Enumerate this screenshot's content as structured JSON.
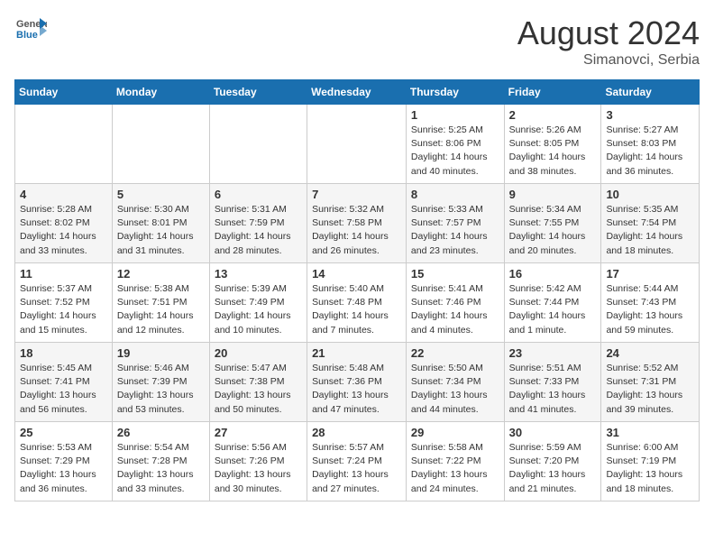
{
  "header": {
    "logo": {
      "general": "General",
      "blue": "Blue"
    },
    "title": "August 2024",
    "location": "Simanovci, Serbia"
  },
  "weekdays": [
    "Sunday",
    "Monday",
    "Tuesday",
    "Wednesday",
    "Thursday",
    "Friday",
    "Saturday"
  ],
  "weeks": [
    [
      {
        "day": "",
        "info": ""
      },
      {
        "day": "",
        "info": ""
      },
      {
        "day": "",
        "info": ""
      },
      {
        "day": "",
        "info": ""
      },
      {
        "day": "1",
        "info": "Sunrise: 5:25 AM\nSunset: 8:06 PM\nDaylight: 14 hours\nand 40 minutes."
      },
      {
        "day": "2",
        "info": "Sunrise: 5:26 AM\nSunset: 8:05 PM\nDaylight: 14 hours\nand 38 minutes."
      },
      {
        "day": "3",
        "info": "Sunrise: 5:27 AM\nSunset: 8:03 PM\nDaylight: 14 hours\nand 36 minutes."
      }
    ],
    [
      {
        "day": "4",
        "info": "Sunrise: 5:28 AM\nSunset: 8:02 PM\nDaylight: 14 hours\nand 33 minutes."
      },
      {
        "day": "5",
        "info": "Sunrise: 5:30 AM\nSunset: 8:01 PM\nDaylight: 14 hours\nand 31 minutes."
      },
      {
        "day": "6",
        "info": "Sunrise: 5:31 AM\nSunset: 7:59 PM\nDaylight: 14 hours\nand 28 minutes."
      },
      {
        "day": "7",
        "info": "Sunrise: 5:32 AM\nSunset: 7:58 PM\nDaylight: 14 hours\nand 26 minutes."
      },
      {
        "day": "8",
        "info": "Sunrise: 5:33 AM\nSunset: 7:57 PM\nDaylight: 14 hours\nand 23 minutes."
      },
      {
        "day": "9",
        "info": "Sunrise: 5:34 AM\nSunset: 7:55 PM\nDaylight: 14 hours\nand 20 minutes."
      },
      {
        "day": "10",
        "info": "Sunrise: 5:35 AM\nSunset: 7:54 PM\nDaylight: 14 hours\nand 18 minutes."
      }
    ],
    [
      {
        "day": "11",
        "info": "Sunrise: 5:37 AM\nSunset: 7:52 PM\nDaylight: 14 hours\nand 15 minutes."
      },
      {
        "day": "12",
        "info": "Sunrise: 5:38 AM\nSunset: 7:51 PM\nDaylight: 14 hours\nand 12 minutes."
      },
      {
        "day": "13",
        "info": "Sunrise: 5:39 AM\nSunset: 7:49 PM\nDaylight: 14 hours\nand 10 minutes."
      },
      {
        "day": "14",
        "info": "Sunrise: 5:40 AM\nSunset: 7:48 PM\nDaylight: 14 hours\nand 7 minutes."
      },
      {
        "day": "15",
        "info": "Sunrise: 5:41 AM\nSunset: 7:46 PM\nDaylight: 14 hours\nand 4 minutes."
      },
      {
        "day": "16",
        "info": "Sunrise: 5:42 AM\nSunset: 7:44 PM\nDaylight: 14 hours\nand 1 minute."
      },
      {
        "day": "17",
        "info": "Sunrise: 5:44 AM\nSunset: 7:43 PM\nDaylight: 13 hours\nand 59 minutes."
      }
    ],
    [
      {
        "day": "18",
        "info": "Sunrise: 5:45 AM\nSunset: 7:41 PM\nDaylight: 13 hours\nand 56 minutes."
      },
      {
        "day": "19",
        "info": "Sunrise: 5:46 AM\nSunset: 7:39 PM\nDaylight: 13 hours\nand 53 minutes."
      },
      {
        "day": "20",
        "info": "Sunrise: 5:47 AM\nSunset: 7:38 PM\nDaylight: 13 hours\nand 50 minutes."
      },
      {
        "day": "21",
        "info": "Sunrise: 5:48 AM\nSunset: 7:36 PM\nDaylight: 13 hours\nand 47 minutes."
      },
      {
        "day": "22",
        "info": "Sunrise: 5:50 AM\nSunset: 7:34 PM\nDaylight: 13 hours\nand 44 minutes."
      },
      {
        "day": "23",
        "info": "Sunrise: 5:51 AM\nSunset: 7:33 PM\nDaylight: 13 hours\nand 41 minutes."
      },
      {
        "day": "24",
        "info": "Sunrise: 5:52 AM\nSunset: 7:31 PM\nDaylight: 13 hours\nand 39 minutes."
      }
    ],
    [
      {
        "day": "25",
        "info": "Sunrise: 5:53 AM\nSunset: 7:29 PM\nDaylight: 13 hours\nand 36 minutes."
      },
      {
        "day": "26",
        "info": "Sunrise: 5:54 AM\nSunset: 7:28 PM\nDaylight: 13 hours\nand 33 minutes."
      },
      {
        "day": "27",
        "info": "Sunrise: 5:56 AM\nSunset: 7:26 PM\nDaylight: 13 hours\nand 30 minutes."
      },
      {
        "day": "28",
        "info": "Sunrise: 5:57 AM\nSunset: 7:24 PM\nDaylight: 13 hours\nand 27 minutes."
      },
      {
        "day": "29",
        "info": "Sunrise: 5:58 AM\nSunset: 7:22 PM\nDaylight: 13 hours\nand 24 minutes."
      },
      {
        "day": "30",
        "info": "Sunrise: 5:59 AM\nSunset: 7:20 PM\nDaylight: 13 hours\nand 21 minutes."
      },
      {
        "day": "31",
        "info": "Sunrise: 6:00 AM\nSunset: 7:19 PM\nDaylight: 13 hours\nand 18 minutes."
      }
    ]
  ]
}
